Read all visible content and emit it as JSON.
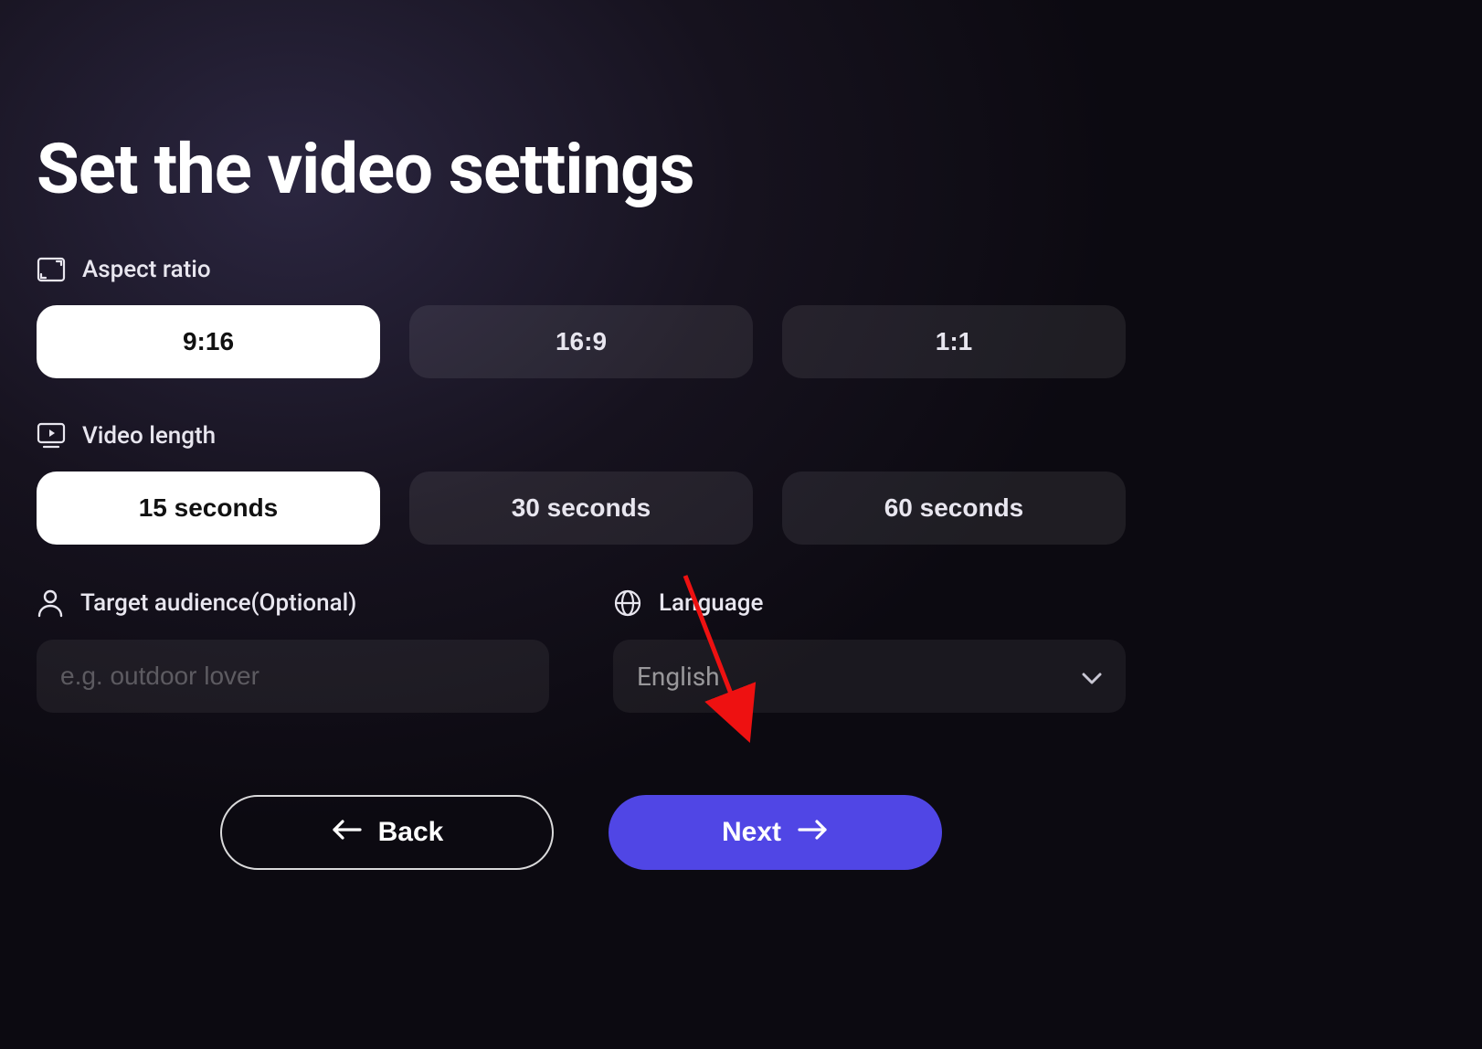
{
  "title": "Set the video settings",
  "sections": {
    "aspect_ratio": {
      "label": "Aspect ratio",
      "options": [
        "9:16",
        "16:9",
        "1:1"
      ],
      "selected_index": 0
    },
    "video_length": {
      "label": "Video length",
      "options": [
        "15 seconds",
        "30 seconds",
        "60 seconds"
      ],
      "selected_index": 0
    },
    "target_audience": {
      "label": "Target audience(Optional)",
      "placeholder": "e.g. outdoor lover",
      "value": ""
    },
    "language": {
      "label": "Language",
      "selected": "English"
    }
  },
  "nav": {
    "back": "Back",
    "next": "Next"
  }
}
